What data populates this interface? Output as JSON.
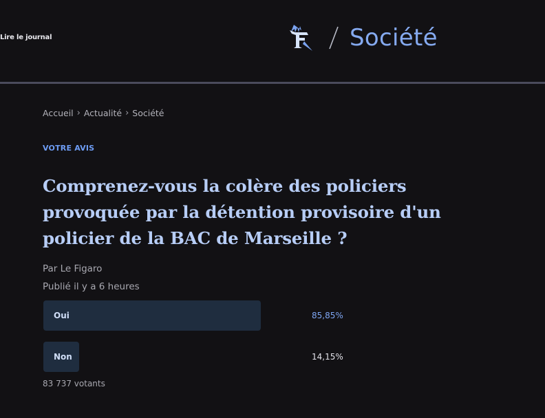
{
  "header": {
    "read_link": "Lire le journal",
    "logo_icon": "le-figaro-f-logo",
    "section": "Société",
    "accent_color": "#85aaf0"
  },
  "breadcrumb": {
    "items": [
      "Accueil",
      "Actualité",
      "Société"
    ],
    "separator_icon": "chevron-right-icon"
  },
  "article": {
    "kicker": "VOTRE AVIS",
    "headline": "Comprenez-vous la colère des policiers provoquée par la détention provisoire d'un policier de la BAC de Marseille ?",
    "byline": "Par Le Figaro",
    "published": "Publié il y a 6 heures"
  },
  "poll": {
    "options": [
      {
        "label": "Oui",
        "percent_text": "85,85%",
        "share": 0.8585,
        "leading": true
      },
      {
        "label": "Non",
        "percent_text": "14,15%",
        "share": 0.1415,
        "leading": false
      }
    ],
    "votes": "83 737 votants",
    "bar_color": "#1f2d3f"
  }
}
